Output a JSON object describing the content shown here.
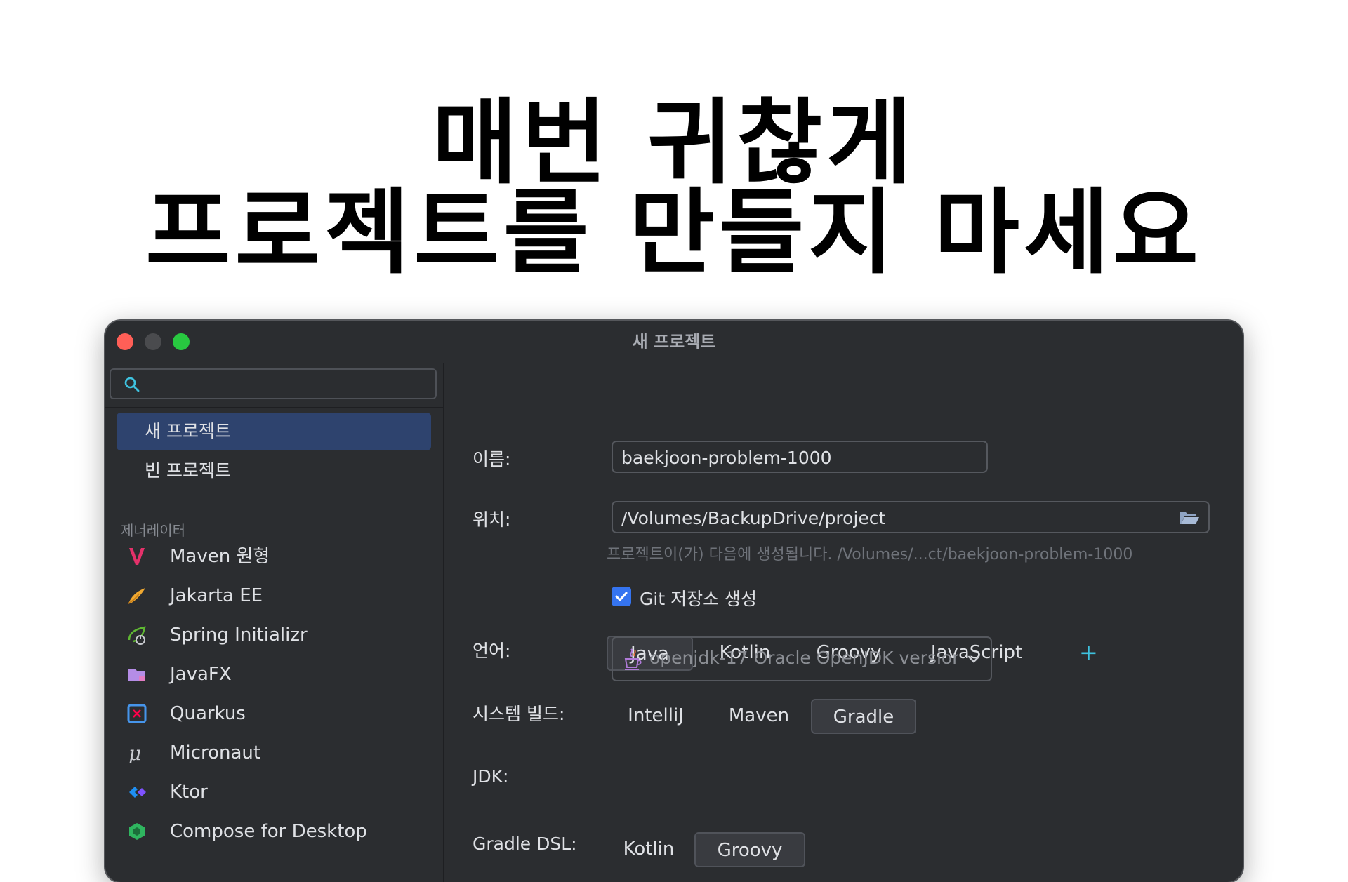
{
  "headline": {
    "line1": "매번 귀찮게",
    "line2": "프로젝트를 만들지 마세요"
  },
  "window": {
    "title": "새 프로젝트"
  },
  "sidebar": {
    "search_placeholder": "",
    "items": [
      {
        "label": "새 프로젝트",
        "selected": true
      },
      {
        "label": "빈 프로젝트",
        "selected": false
      }
    ],
    "generators_header": "제너레이터",
    "generators": [
      {
        "label": "Maven 원형",
        "icon": "maven-icon"
      },
      {
        "label": "Jakarta EE",
        "icon": "jakarta-ee-icon"
      },
      {
        "label": "Spring Initializr",
        "icon": "spring-icon"
      },
      {
        "label": "JavaFX",
        "icon": "javafx-folder-icon"
      },
      {
        "label": "Quarkus",
        "icon": "quarkus-icon"
      },
      {
        "label": "Micronaut",
        "icon": "micronaut-icon"
      },
      {
        "label": "Ktor",
        "icon": "ktor-icon"
      },
      {
        "label": "Compose for Desktop",
        "icon": "compose-icon"
      }
    ]
  },
  "form": {
    "name_label": "이름:",
    "name_value": "baekjoon-problem-1000",
    "location_label": "위치:",
    "location_value": "/Volumes/BackupDrive/project",
    "location_hint": "프로젝트이(가) 다음에 생성됩니다. /Volumes/...ct/baekjoon-problem-1000",
    "git_label": "Git 저장소 생성",
    "git_checked": true,
    "language_label": "언어:",
    "languages": [
      {
        "label": "Java",
        "active": true
      },
      {
        "label": "Kotlin",
        "active": false
      },
      {
        "label": "Groovy",
        "active": false
      },
      {
        "label": "JavaScript",
        "active": false
      }
    ],
    "add_language": "+",
    "build_label": "시스템 빌드:",
    "builds": [
      {
        "label": "IntelliJ",
        "active": false
      },
      {
        "label": "Maven",
        "active": false
      },
      {
        "label": "Gradle",
        "active": true
      }
    ],
    "jdk_label": "JDK:",
    "jdk_value": "openjdk-17 Oracle OpenJDK version 17",
    "dsl_label": "Gradle DSL:",
    "dsl_options": [
      {
        "label": "Kotlin",
        "active": false
      },
      {
        "label": "Groovy",
        "active": true
      }
    ]
  },
  "colors": {
    "window_bg": "#2b2d30",
    "selection": "#2e436e",
    "accent_blue": "#3574f0",
    "plus_cyan": "#3ec2df",
    "close": "#ff5f57",
    "maximize": "#28c840"
  }
}
